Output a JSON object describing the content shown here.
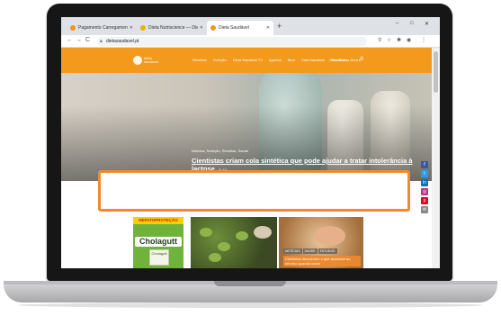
{
  "browser": {
    "tabs": [
      {
        "title": "Pagamento Carregamento Sucesso — ",
        "favicon": "orange-leaf-icon"
      },
      {
        "title": "Dieta Nutriscience — Dietas e ",
        "favicon": "yellow-site-icon"
      },
      {
        "title": "Dieta Saudável",
        "favicon": "orange-leaf-icon",
        "active": true
      }
    ],
    "new_tab": "+",
    "window_controls": [
      "–",
      "□",
      "✕"
    ],
    "url": "dietasaudavel.pt",
    "nav": {
      "back": "←",
      "forward": "→",
      "reload": "C"
    }
  },
  "site": {
    "logo_text": "dieta saudável",
    "menu": [
      "Receitas",
      "Nutrição",
      "Dieta Saudável TV",
      "Agenda",
      "Bem",
      "Vida Saudável",
      "Receitas"
    ],
    "header_right": "Consultorias   Área ▾",
    "search_icon": "⚲"
  },
  "hero": {
    "categories": "Notícias, Nutrição, Receitas, Saúde",
    "title": "Cientistas criam cola sintética que pode ajudar a tratar intolerância à lactose",
    "meta": "⊙ 44"
  },
  "ads": {
    "band": "HEPATOPROTEÇÃO",
    "brand": "Cholagutt",
    "pack": "Cholagutt",
    "tags": [
      "NOTÍCIAS",
      "SAÚDE",
      "ESTUDOS"
    ],
    "caption": "Cientistas descobrem o que acontece ao cérebro quando come"
  },
  "share": [
    {
      "icon": "facebook-icon",
      "label": "f",
      "color": "#3b5998"
    },
    {
      "icon": "twitter-icon",
      "label": "t",
      "color": "#1da1f2"
    },
    {
      "icon": "linkedin-icon",
      "label": "in",
      "color": "#0077b5"
    },
    {
      "icon": "instagram-icon",
      "label": "◎",
      "color": "#c13584"
    },
    {
      "icon": "pinterest-icon",
      "label": "p",
      "color": "#e60023"
    },
    {
      "icon": "email-icon",
      "label": "✉",
      "color": "#888888"
    }
  ],
  "colors": {
    "accent": "#f39a1d",
    "highlight": "#f08a2b"
  }
}
